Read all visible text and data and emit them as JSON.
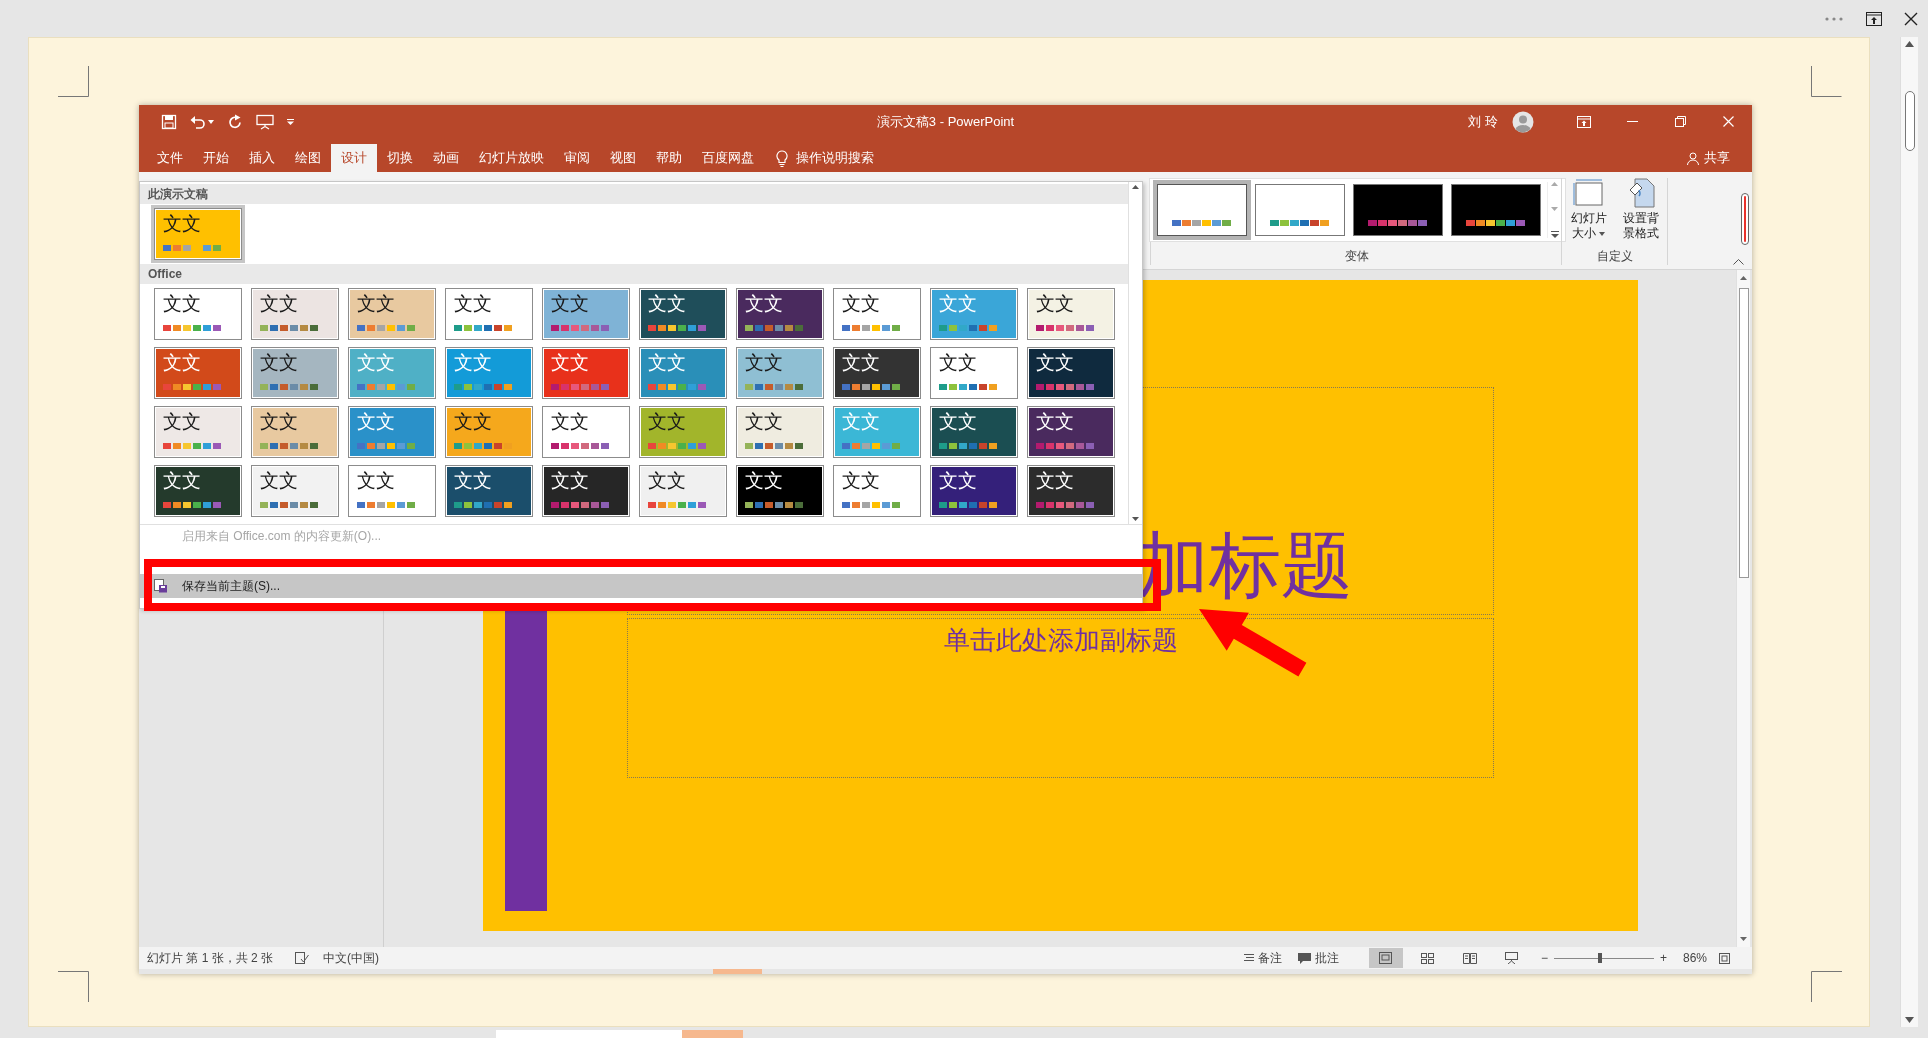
{
  "window": {
    "title": "演示文稿3 - PowerPoint",
    "user": "刘 玲"
  },
  "tabs": [
    {
      "label": "文件",
      "selected": false
    },
    {
      "label": "开始",
      "selected": false
    },
    {
      "label": "插入",
      "selected": false
    },
    {
      "label": "绘图",
      "selected": false
    },
    {
      "label": "设计",
      "selected": true
    },
    {
      "label": "切换",
      "selected": false
    },
    {
      "label": "动画",
      "selected": false
    },
    {
      "label": "幻灯片放映",
      "selected": false
    },
    {
      "label": "审阅",
      "selected": false
    },
    {
      "label": "视图",
      "selected": false
    },
    {
      "label": "帮助",
      "selected": false
    },
    {
      "label": "百度网盘",
      "selected": false
    }
  ],
  "tell_me": "操作说明搜索",
  "share": "共享",
  "ribbon": {
    "variants": {
      "label": "变体",
      "items": [
        {
          "color": "#ffffff",
          "selected": true
        },
        {
          "color": "#ffffff",
          "selected": false
        },
        {
          "color": "#000000",
          "selected": false
        },
        {
          "color": "#000000",
          "selected": false
        }
      ]
    },
    "customize": {
      "label": "自定义",
      "buttons": [
        {
          "kind": "size",
          "label": "幻灯片大小"
        },
        {
          "kind": "background",
          "label": "设置背景格式"
        }
      ]
    }
  },
  "theme_gallery": {
    "sections": [
      {
        "title": "此演示文稿",
        "themes": [
          {
            "text": "文文",
            "color": "#ffc000",
            "selected": true
          }
        ]
      },
      {
        "title": "Office",
        "themes": [
          {
            "text": "文文",
            "color": "#ffffff",
            "selected": false
          },
          {
            "text": "文文",
            "color": "#ece4e2",
            "selected": false
          },
          {
            "text": "文文",
            "color": "#e8c9a0",
            "selected": false
          },
          {
            "text": "文文",
            "color": "#ffffff",
            "selected": false
          },
          {
            "text": "文文",
            "color": "#7fb3d6",
            "selected": false
          },
          {
            "text": "文文",
            "color": "#1f4e5a",
            "selected": false
          },
          {
            "text": "文文",
            "color": "#4a2a5e",
            "selected": false
          },
          {
            "text": "文文",
            "color": "#ffffff",
            "selected": false
          },
          {
            "text": "文文",
            "color": "#3aa6d8",
            "selected": false
          },
          {
            "text": "文文",
            "color": "#f4f2e4",
            "selected": false
          },
          {
            "text": "文文",
            "color": "#d24a1a",
            "selected": false
          },
          {
            "text": "文文",
            "color": "#a5b6c0",
            "selected": false
          },
          {
            "text": "文文",
            "color": "#4fb0c6",
            "selected": false
          },
          {
            "text": "文文",
            "color": "#139bd8",
            "selected": false
          },
          {
            "text": "文文",
            "color": "#e8311b",
            "selected": false
          },
          {
            "text": "文文",
            "color": "#2a8fb8",
            "selected": false
          },
          {
            "text": "文文",
            "color": "#8fbfd3",
            "selected": false
          },
          {
            "text": "文文",
            "color": "#333333",
            "selected": false
          },
          {
            "text": "文文",
            "color": "#ffffff",
            "selected": false
          },
          {
            "text": "文文",
            "color": "#0f2a3e",
            "selected": false
          },
          {
            "text": "文文",
            "color": "#eee8e6",
            "selected": false
          },
          {
            "text": "文文",
            "color": "#e8c9a0",
            "selected": false
          },
          {
            "text": "文文",
            "color": "#2a91c9",
            "selected": false
          },
          {
            "text": "文文",
            "color": "#f5a81c",
            "selected": false
          },
          {
            "text": "文文",
            "color": "#ffffff",
            "selected": false
          },
          {
            "text": "文文",
            "color": "#a2b52b",
            "selected": false
          },
          {
            "text": "文文",
            "color": "#efece0",
            "selected": false
          },
          {
            "text": "文文",
            "color": "#3bb7d6",
            "selected": false
          },
          {
            "text": "文文",
            "color": "#1b4e52",
            "selected": false
          },
          {
            "text": "文文",
            "color": "#4a2a5e",
            "selected": false
          },
          {
            "text": "文文",
            "color": "#243a2c",
            "selected": false
          },
          {
            "text": "文文",
            "color": "#f2f2f2",
            "selected": false
          },
          {
            "text": "文文",
            "color": "#ffffff",
            "selected": false
          },
          {
            "text": "文文",
            "color": "#1b4e6b",
            "selected": false
          },
          {
            "text": "文文",
            "color": "#262626",
            "selected": false
          },
          {
            "text": "文文",
            "color": "#f0f0f0",
            "selected": false
          },
          {
            "text": "文文",
            "color": "#000000",
            "selected": false
          },
          {
            "text": "文文",
            "color": "#ffffff",
            "selected": false
          },
          {
            "text": "文文",
            "color": "#34207a",
            "selected": false
          },
          {
            "text": "文文",
            "color": "#2c2c2c",
            "selected": false
          }
        ]
      }
    ],
    "menu": [
      {
        "label": "启用来自 Office.com 的内容更新(O)...",
        "disabled": true,
        "highlighted": false
      },
      {
        "label": "保存当前主题(S)...",
        "disabled": false,
        "highlighted": true
      }
    ]
  },
  "slide": {
    "title": "加标题",
    "subtitle": "单击此处添加副标题"
  },
  "status_bar": {
    "slide_info": "幻灯片 第 1 张，共 2 张",
    "language": "中文(中国)",
    "notes": "备注",
    "comments": "批注",
    "views": [
      {
        "kind": "normal",
        "selected": true
      },
      {
        "kind": "sorter",
        "selected": false
      },
      {
        "kind": "reading",
        "selected": false
      },
      {
        "kind": "slideshow",
        "selected": false
      }
    ],
    "zoom": {
      "out": "−",
      "in": "+",
      "level": 0.46,
      "reading": "86%"
    }
  }
}
